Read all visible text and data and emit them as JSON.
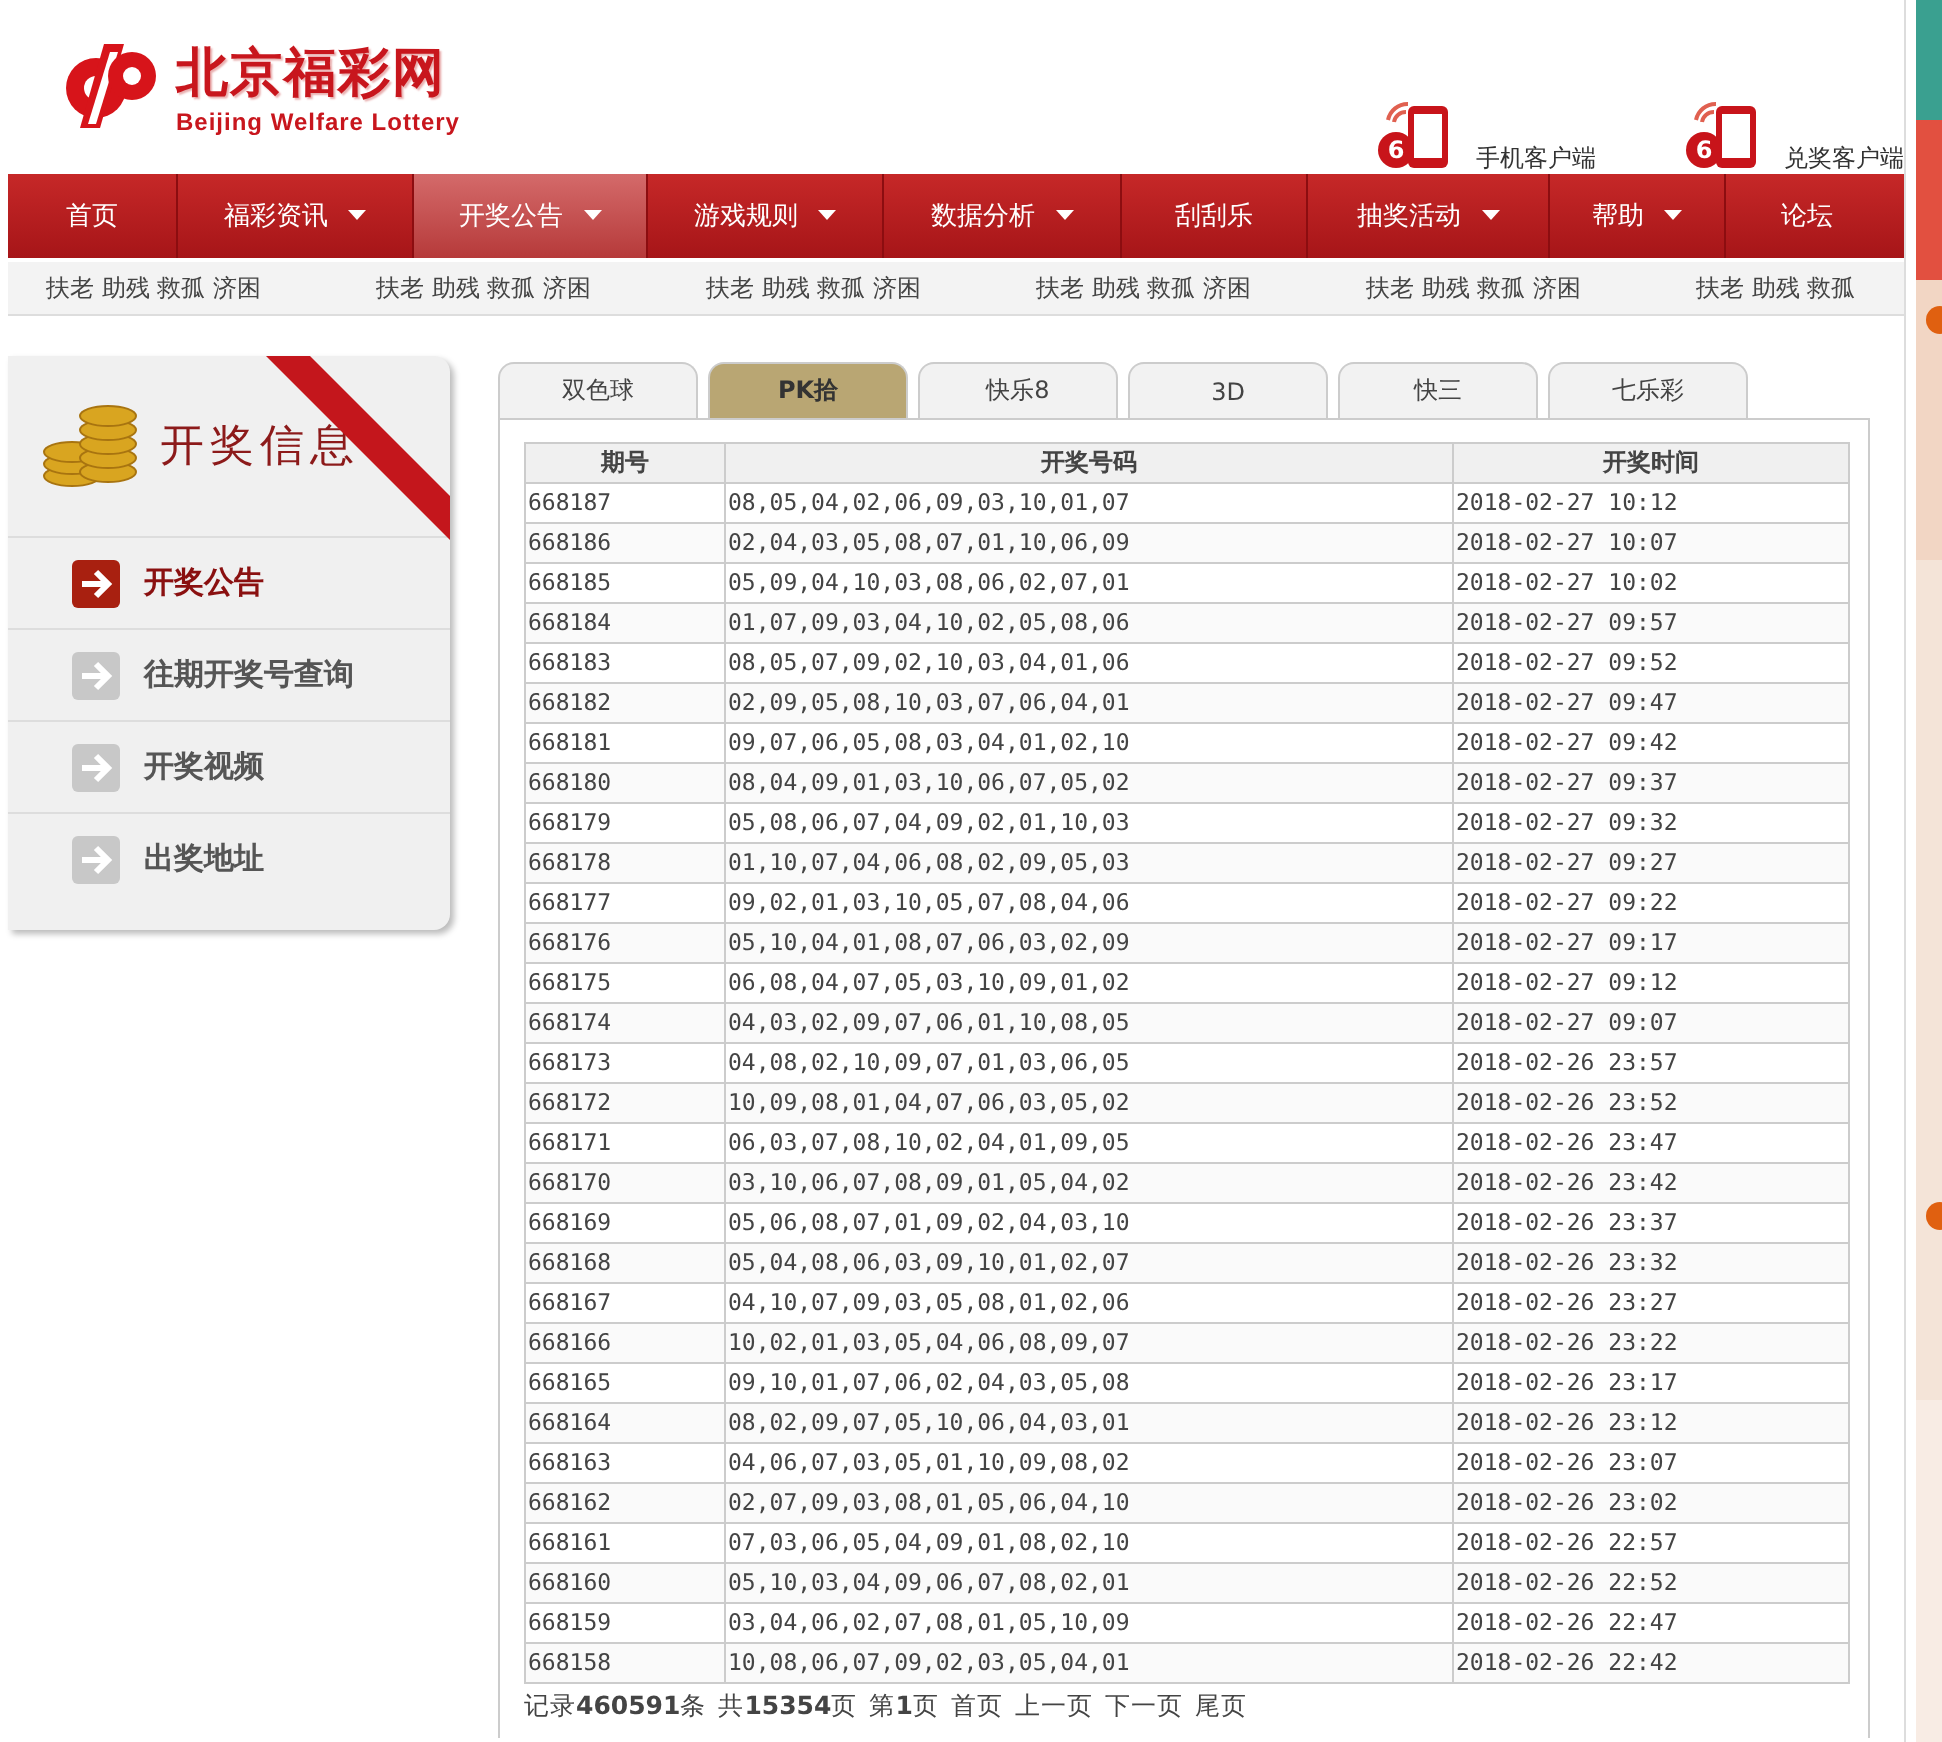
{
  "header": {
    "logo_title": "北京福彩网",
    "logo_subtitle": "Beijing Welfare Lottery",
    "apps": [
      {
        "badge": "6",
        "label": "手机客户端"
      },
      {
        "badge": "6",
        "label": "兑奖客户端"
      }
    ]
  },
  "nav": [
    {
      "label": "首页",
      "has_menu": false,
      "selected": false
    },
    {
      "label": "福彩资讯",
      "has_menu": true,
      "selected": false
    },
    {
      "label": "开奖公告",
      "has_menu": true,
      "selected": true
    },
    {
      "label": "游戏规则",
      "has_menu": true,
      "selected": false
    },
    {
      "label": "数据分析",
      "has_menu": true,
      "selected": false
    },
    {
      "label": "刮刮乐",
      "has_menu": false,
      "selected": false
    },
    {
      "label": "抽奖活动",
      "has_menu": true,
      "selected": false
    },
    {
      "label": "帮助",
      "has_menu": true,
      "selected": false
    },
    {
      "label": "论坛",
      "has_menu": false,
      "selected": false
    }
  ],
  "ticker": [
    "扶老 助残 救孤 济困",
    "扶老 助残 救孤 济困",
    "扶老 助残 救孤 济困",
    "扶老 助残 救孤 济困",
    "扶老 助残 救孤 济困",
    "扶老 助残 救孤"
  ],
  "sidebar": {
    "title": "开奖信息",
    "items": [
      {
        "label": "开奖公告",
        "selected": true
      },
      {
        "label": "往期开奖号查询",
        "selected": false
      },
      {
        "label": "开奖视频",
        "selected": false
      },
      {
        "label": "出奖地址",
        "selected": false
      }
    ]
  },
  "tabs": [
    {
      "label": "双色球",
      "selected": false
    },
    {
      "label": "PK拾",
      "selected": true
    },
    {
      "label": "快乐8",
      "selected": false
    },
    {
      "label": "3D",
      "selected": false
    },
    {
      "label": "快三",
      "selected": false
    },
    {
      "label": "七乐彩",
      "selected": false
    }
  ],
  "table": {
    "columns": [
      "期号",
      "开奖号码",
      "开奖时间"
    ],
    "rows": [
      [
        "668187",
        "08,05,04,02,06,09,03,10,01,07",
        "2018-02-27 10:12"
      ],
      [
        "668186",
        "02,04,03,05,08,07,01,10,06,09",
        "2018-02-27 10:07"
      ],
      [
        "668185",
        "05,09,04,10,03,08,06,02,07,01",
        "2018-02-27 10:02"
      ],
      [
        "668184",
        "01,07,09,03,04,10,02,05,08,06",
        "2018-02-27 09:57"
      ],
      [
        "668183",
        "08,05,07,09,02,10,03,04,01,06",
        "2018-02-27 09:52"
      ],
      [
        "668182",
        "02,09,05,08,10,03,07,06,04,01",
        "2018-02-27 09:47"
      ],
      [
        "668181",
        "09,07,06,05,08,03,04,01,02,10",
        "2018-02-27 09:42"
      ],
      [
        "668180",
        "08,04,09,01,03,10,06,07,05,02",
        "2018-02-27 09:37"
      ],
      [
        "668179",
        "05,08,06,07,04,09,02,01,10,03",
        "2018-02-27 09:32"
      ],
      [
        "668178",
        "01,10,07,04,06,08,02,09,05,03",
        "2018-02-27 09:27"
      ],
      [
        "668177",
        "09,02,01,03,10,05,07,08,04,06",
        "2018-02-27 09:22"
      ],
      [
        "668176",
        "05,10,04,01,08,07,06,03,02,09",
        "2018-02-27 09:17"
      ],
      [
        "668175",
        "06,08,04,07,05,03,10,09,01,02",
        "2018-02-27 09:12"
      ],
      [
        "668174",
        "04,03,02,09,07,06,01,10,08,05",
        "2018-02-27 09:07"
      ],
      [
        "668173",
        "04,08,02,10,09,07,01,03,06,05",
        "2018-02-26 23:57"
      ],
      [
        "668172",
        "10,09,08,01,04,07,06,03,05,02",
        "2018-02-26 23:52"
      ],
      [
        "668171",
        "06,03,07,08,10,02,04,01,09,05",
        "2018-02-26 23:47"
      ],
      [
        "668170",
        "03,10,06,07,08,09,01,05,04,02",
        "2018-02-26 23:42"
      ],
      [
        "668169",
        "05,06,08,07,01,09,02,04,03,10",
        "2018-02-26 23:37"
      ],
      [
        "668168",
        "05,04,08,06,03,09,10,01,02,07",
        "2018-02-26 23:32"
      ],
      [
        "668167",
        "04,10,07,09,03,05,08,01,02,06",
        "2018-02-26 23:27"
      ],
      [
        "668166",
        "10,02,01,03,05,04,06,08,09,07",
        "2018-02-26 23:22"
      ],
      [
        "668165",
        "09,10,01,07,06,02,04,03,05,08",
        "2018-02-26 23:17"
      ],
      [
        "668164",
        "08,02,09,07,05,10,06,04,03,01",
        "2018-02-26 23:12"
      ],
      [
        "668163",
        "04,06,07,03,05,01,10,09,08,02",
        "2018-02-26 23:07"
      ],
      [
        "668162",
        "02,07,09,03,08,01,05,06,04,10",
        "2018-02-26 23:02"
      ],
      [
        "668161",
        "07,03,06,05,04,09,01,08,02,10",
        "2018-02-26 22:57"
      ],
      [
        "668160",
        "05,10,03,04,09,06,07,08,02,01",
        "2018-02-26 22:52"
      ],
      [
        "668159",
        "03,04,06,02,07,08,01,05,10,09",
        "2018-02-26 22:47"
      ],
      [
        "668158",
        "10,08,06,07,09,02,03,05,04,01",
        "2018-02-26 22:42"
      ]
    ]
  },
  "pagination": {
    "summary": [
      "记录**460591**条",
      "共**15354**页",
      "第**1**页"
    ],
    "links": [
      "首页",
      "上一页",
      "下一页",
      "尾页"
    ]
  }
}
